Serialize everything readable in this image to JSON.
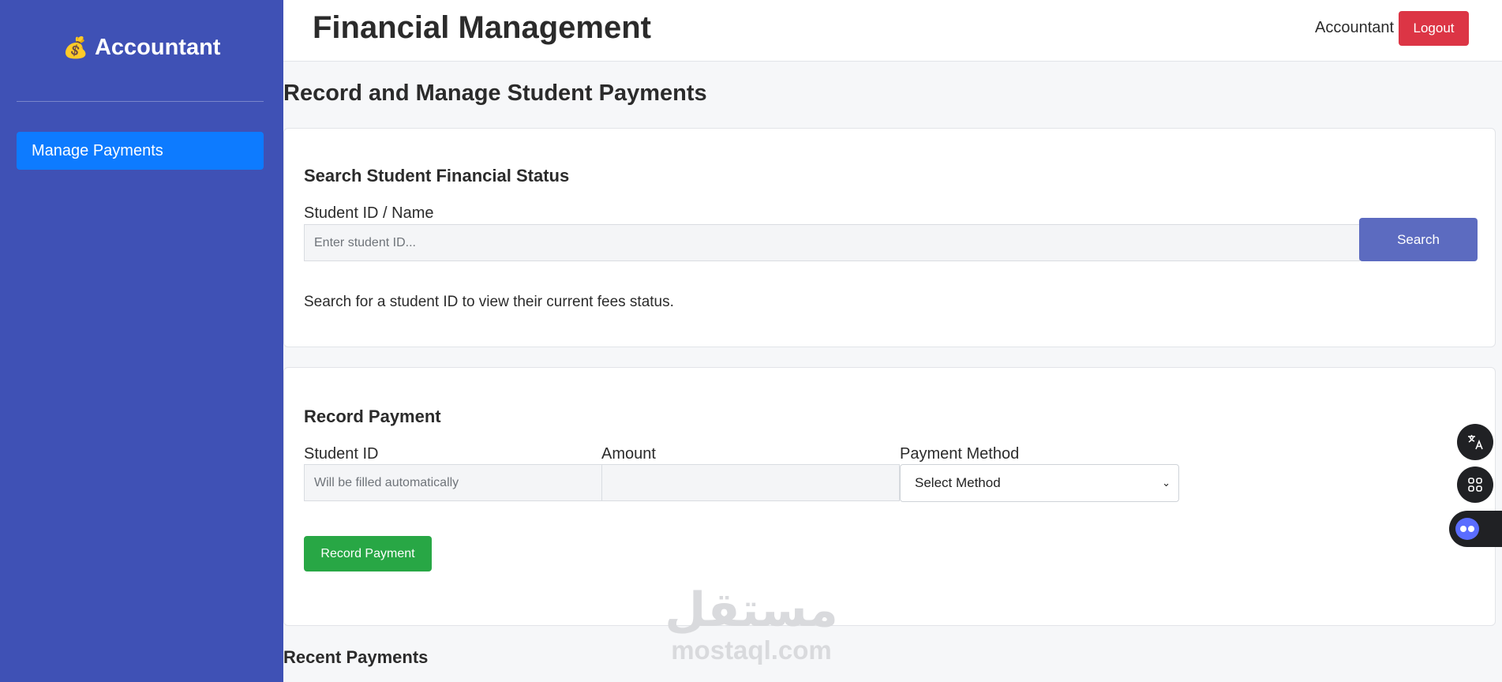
{
  "sidebar": {
    "brand": "Accountant",
    "brand_icon": "💰",
    "items": [
      {
        "label": "Manage Payments"
      }
    ]
  },
  "header": {
    "title": "Financial Management",
    "role": "Accountant",
    "logout_label": "Logout"
  },
  "main": {
    "heading": "Record and Manage Student Payments",
    "search": {
      "title": "Search Student Financial Status",
      "field_label": "Student ID / Name",
      "placeholder": "Enter student ID...",
      "button_label": "Search",
      "hint": "Search for a student ID to view their current fees status."
    },
    "record": {
      "title": "Record Payment",
      "student_id_label": "Student ID",
      "student_id_placeholder": "Will be filled automatically",
      "amount_label": "Amount",
      "amount_value": "",
      "method_label": "Payment Method",
      "method_selected": "Select Method",
      "button_label": "Record Payment"
    },
    "recent_title": "Recent Payments"
  },
  "watermark": {
    "arabic": "مستقل",
    "latin": "mostaql.com"
  },
  "icons": {
    "translate": "translate-icon",
    "apps": "apps-icon",
    "assistant": "assistant-bot-icon"
  },
  "colors": {
    "sidebar": "#3f51b5",
    "nav_active": "#0d7bff",
    "logout": "#dc3545",
    "search": "#5c6bc0",
    "record": "#28a745"
  }
}
